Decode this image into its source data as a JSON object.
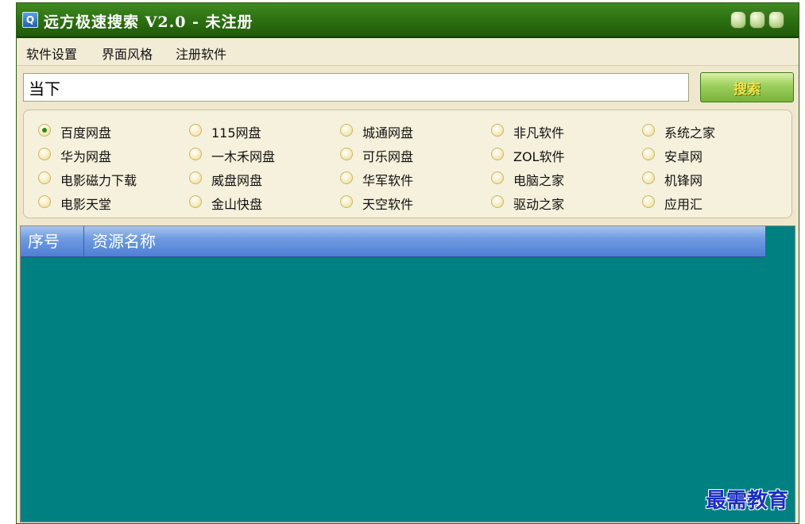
{
  "window": {
    "title": "远方极速搜索  V2.0 - 未注册",
    "icon": "search-app-icon"
  },
  "menu": [
    "软件设置",
    "界面风格",
    "注册软件"
  ],
  "search": {
    "value": "当下",
    "button_label": "搜索"
  },
  "sites": [
    {
      "label": "百度网盘",
      "checked": true
    },
    {
      "label": "115网盘",
      "checked": false
    },
    {
      "label": "城通网盘",
      "checked": false
    },
    {
      "label": "非凡软件",
      "checked": false
    },
    {
      "label": "系统之家",
      "checked": false
    },
    {
      "label": "华为网盘",
      "checked": false
    },
    {
      "label": "一木禾网盘",
      "checked": false
    },
    {
      "label": "可乐网盘",
      "checked": false
    },
    {
      "label": "ZOL软件",
      "checked": false
    },
    {
      "label": "安卓网",
      "checked": false
    },
    {
      "label": "电影磁力下载",
      "checked": false
    },
    {
      "label": "威盘网盘",
      "checked": false
    },
    {
      "label": "华军软件",
      "checked": false
    },
    {
      "label": "电脑之家",
      "checked": false
    },
    {
      "label": "机锋网",
      "checked": false
    },
    {
      "label": "电影天堂",
      "checked": false
    },
    {
      "label": "金山快盘",
      "checked": false
    },
    {
      "label": "天空软件",
      "checked": false
    },
    {
      "label": "驱动之家",
      "checked": false
    },
    {
      "label": "应用汇",
      "checked": false
    }
  ],
  "results": {
    "columns": [
      "序号",
      "资源名称"
    ],
    "rows": []
  },
  "watermark": "最需教育",
  "colors": {
    "titlebar": "#2f7314",
    "results_bg": "#008080",
    "header": "#6f9be0",
    "search_button": "#9ccf5c"
  }
}
